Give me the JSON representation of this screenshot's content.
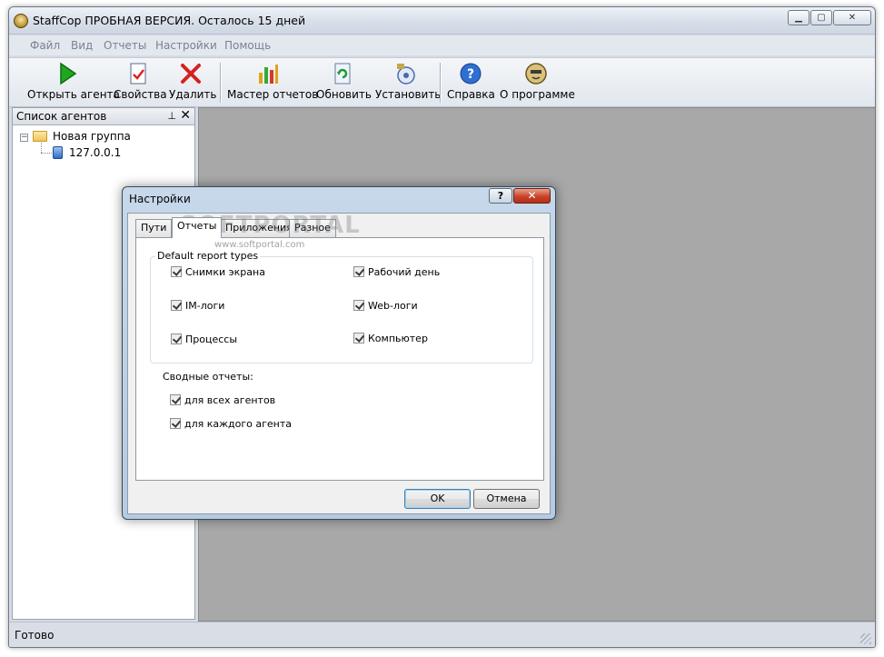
{
  "window": {
    "title": "StaffCop ПРОБНАЯ ВЕРСИЯ. Осталось 15 дней"
  },
  "menu": [
    "Файл",
    "Вид",
    "Отчеты",
    "Настройки",
    "Помощь"
  ],
  "toolbar": {
    "open_agent": "Открыть агента",
    "properties": "Свойства",
    "delete": "Удалить",
    "report_wizard": "Мастер отчетов",
    "refresh": "Обновить",
    "install": "Установить",
    "help": "Справка",
    "about": "О программе"
  },
  "agents_panel": {
    "title": "Список агентов",
    "group": "Новая группа",
    "agent": "127.0.0.1"
  },
  "status": {
    "text": "Готово"
  },
  "dialog": {
    "title": "Настройки",
    "help_label": "?",
    "tabs": [
      "Пути",
      "Отчеты",
      "Приложения",
      "Разное"
    ],
    "watermark": "SOFTPORTAL",
    "watermark_url": "www.softportal.com",
    "group_title": "Default report types",
    "report_types": [
      {
        "label": "Снимки экрана",
        "checked": true
      },
      {
        "label": "Рабочий день",
        "checked": true
      },
      {
        "label": "IM-логи",
        "checked": true
      },
      {
        "label": "Web-логи",
        "checked": true
      },
      {
        "label": "Процессы",
        "checked": true
      },
      {
        "label": "Компьютер",
        "checked": true
      }
    ],
    "summary_title": "Сводные отчеты:",
    "summary": [
      {
        "label": "для всех агентов",
        "checked": true
      },
      {
        "label": "для каждого агента",
        "checked": true
      }
    ],
    "ok": "OK",
    "cancel": "Отмена"
  },
  "colors": {
    "accent": "#3c7fb1",
    "workspace": "#a8a8a8",
    "close": "#c8432a"
  },
  "icons": [
    "app-icon",
    "play-icon",
    "properties-icon",
    "delete-icon",
    "chart-icon",
    "refresh-icon",
    "install-icon",
    "help-icon",
    "about-icon",
    "folder-icon",
    "computer-icon",
    "pin-icon",
    "close-icon"
  ]
}
